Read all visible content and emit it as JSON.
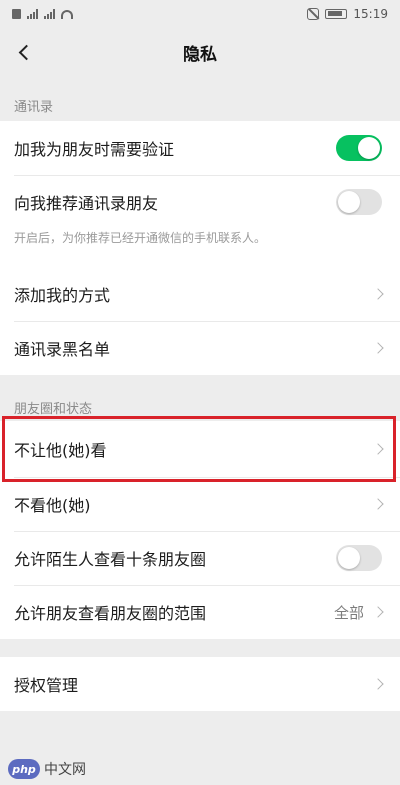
{
  "status_bar": {
    "time": "15:19",
    "icons": [
      "sim-icon",
      "signal-icon",
      "signal-icon",
      "wifi-icon",
      "mute-icon",
      "battery-icon"
    ]
  },
  "nav": {
    "title": "隐私",
    "back_icon": "chevron-left-icon"
  },
  "sections": {
    "contacts": {
      "label": "通讯录",
      "items": [
        {
          "label": "加我为朋友时需要验证",
          "control": "toggle",
          "on": true
        },
        {
          "label": "向我推荐通讯录朋友",
          "control": "toggle",
          "on": false,
          "hint": "开启后，为你推荐已经开通微信的手机联系人。"
        },
        {
          "label": "添加我的方式",
          "control": "chevron"
        },
        {
          "label": "通讯录黑名单",
          "control": "chevron"
        }
      ]
    },
    "moments": {
      "label": "朋友圈和状态",
      "items": [
        {
          "label": "不让他(她)看",
          "control": "chevron"
        },
        {
          "label": "不看他(她)",
          "control": "chevron"
        },
        {
          "label": "允许陌生人查看十条朋友圈",
          "control": "toggle",
          "on": false
        },
        {
          "label": "允许朋友查看朋友圈的范围",
          "value": "全部",
          "control": "chevron"
        }
      ]
    },
    "auth": {
      "items": [
        {
          "label": "授权管理",
          "control": "chevron"
        }
      ]
    }
  },
  "colors": {
    "toggle_on": "#07c160",
    "highlight": "#d9222a",
    "background": "#ededed"
  },
  "watermark": {
    "logo_text": "php",
    "text": "中文网"
  }
}
